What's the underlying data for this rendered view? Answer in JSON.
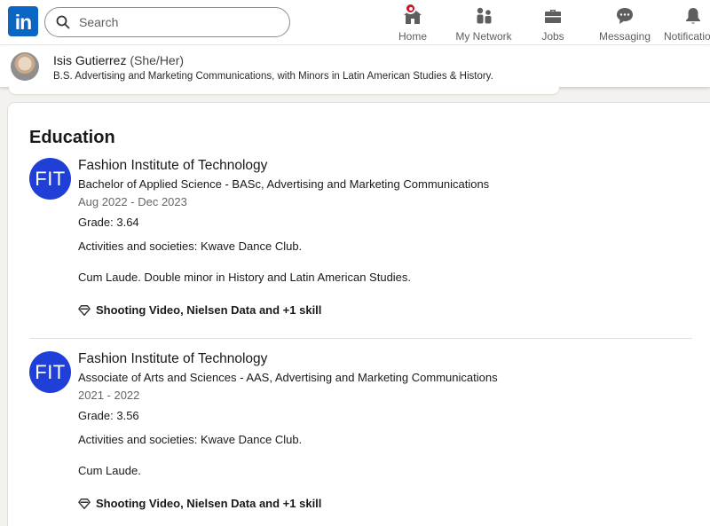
{
  "nav": {
    "logo_text": "in",
    "search_placeholder": "Search",
    "items": [
      {
        "label": "Home",
        "icon": "home-icon"
      },
      {
        "label": "My Network",
        "icon": "network-icon"
      },
      {
        "label": "Jobs",
        "icon": "briefcase-icon"
      },
      {
        "label": "Messaging",
        "icon": "messaging-icon"
      },
      {
        "label": "Notifications",
        "icon": "bell-icon"
      }
    ],
    "accent_color": "#0a66c2",
    "badge_color": "#cb112d"
  },
  "profile": {
    "name": "Isis Gutierrez",
    "pronouns": "(She/Her)",
    "headline": "B.S. Advertising and Marketing Communications, with Minors in Latin American Studies & History."
  },
  "education": {
    "title": "Education",
    "entries": [
      {
        "logo_text": "FIT",
        "school": "Fashion Institute of Technology",
        "degree": "Bachelor of Applied Science - BASc, Advertising and Marketing Communications",
        "dates": "Aug 2022 - Dec 2023",
        "grade": "Grade: 3.64",
        "activities": "Activities and societies: Kwave Dance Club.",
        "description": "Cum Laude. Double minor in History and Latin American Studies.",
        "skills": "Shooting Video, Nielsen Data and +1 skill"
      },
      {
        "logo_text": "FIT",
        "school": "Fashion Institute of Technology",
        "degree": "Associate of Arts and Sciences - AAS, Advertising and Marketing Communications",
        "dates": "2021 - 2022",
        "grade": "Grade: 3.56",
        "activities": "Activities and societies: Kwave Dance Club.",
        "description": "Cum Laude.",
        "skills": "Shooting Video, Nielsen Data and +1 skill"
      }
    ]
  }
}
